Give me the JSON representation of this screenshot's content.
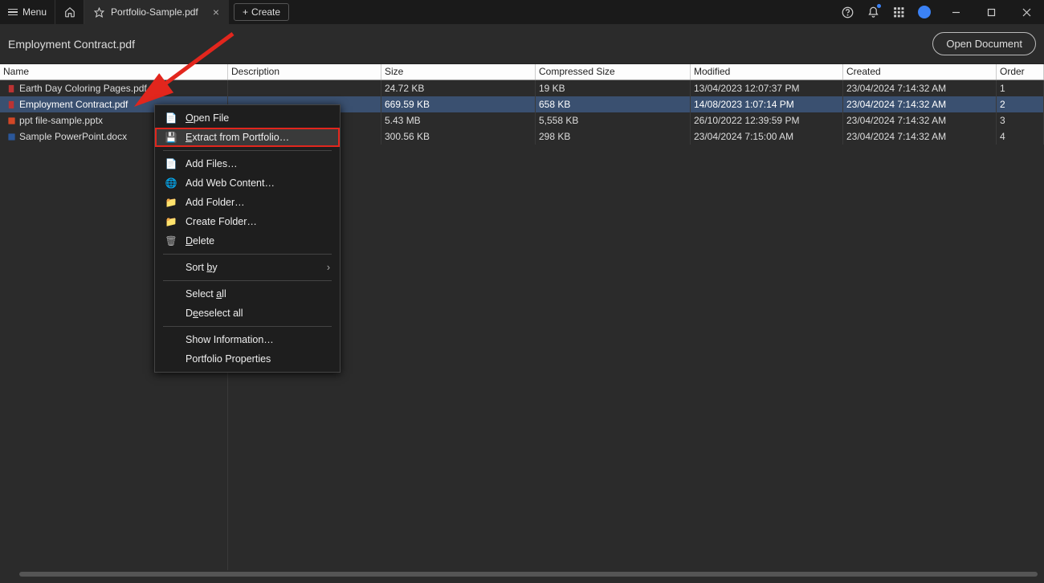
{
  "titleBar": {
    "menu": "Menu",
    "tabTitle": "Portfolio-Sample.pdf",
    "create": "Create"
  },
  "subBar": {
    "docTitle": "Employment Contract.pdf",
    "openDoc": "Open Document"
  },
  "columns": {
    "name": "Name",
    "description": "Description",
    "size": "Size",
    "compressed": "Compressed Size",
    "modified": "Modified",
    "created": "Created",
    "order": "Order"
  },
  "rows": [
    {
      "name": "Earth Day Coloring Pages.pdf",
      "desc": "",
      "size": "24.72 KB",
      "comp": "19 KB",
      "mod": "13/04/2023 12:07:37 PM",
      "created": "23/04/2024 7:14:32 AM",
      "order": "1",
      "type": "pdf"
    },
    {
      "name": "Employment Contract.pdf",
      "desc": "",
      "size": "669.59 KB",
      "comp": "658 KB",
      "mod": "14/08/2023 1:07:14 PM",
      "created": "23/04/2024 7:14:32 AM",
      "order": "2",
      "type": "pdf"
    },
    {
      "name": "ppt file-sample.pptx",
      "desc": "",
      "size": "5.43 MB",
      "comp": "5,558 KB",
      "mod": "26/10/2022 12:39:59 PM",
      "created": "23/04/2024 7:14:32 AM",
      "order": "3",
      "type": "pptx"
    },
    {
      "name": "Sample PowerPoint.docx",
      "desc": "",
      "size": "300.56 KB",
      "comp": "298 KB",
      "mod": "23/04/2024 7:15:00 AM",
      "created": "23/04/2024 7:14:32 AM",
      "order": "4",
      "type": "docx"
    }
  ],
  "contextMenu": {
    "open": "pen File",
    "extract": "xtract from Portfolio…",
    "addFiles": "Add Files…",
    "addWeb": "Add Web Content…",
    "addFolder": "Add Folder…",
    "createFolder": "Create Folder…",
    "delete": "elete",
    "sort": "Sort ",
    "sort2": "y",
    "selectAll": "Select ",
    "selectAll2": "ll",
    "deselect": "eselect all",
    "showInfo": "Show Information…",
    "showInfoU": "I",
    "props": "Portfolio Properties",
    "propsU": "o"
  }
}
